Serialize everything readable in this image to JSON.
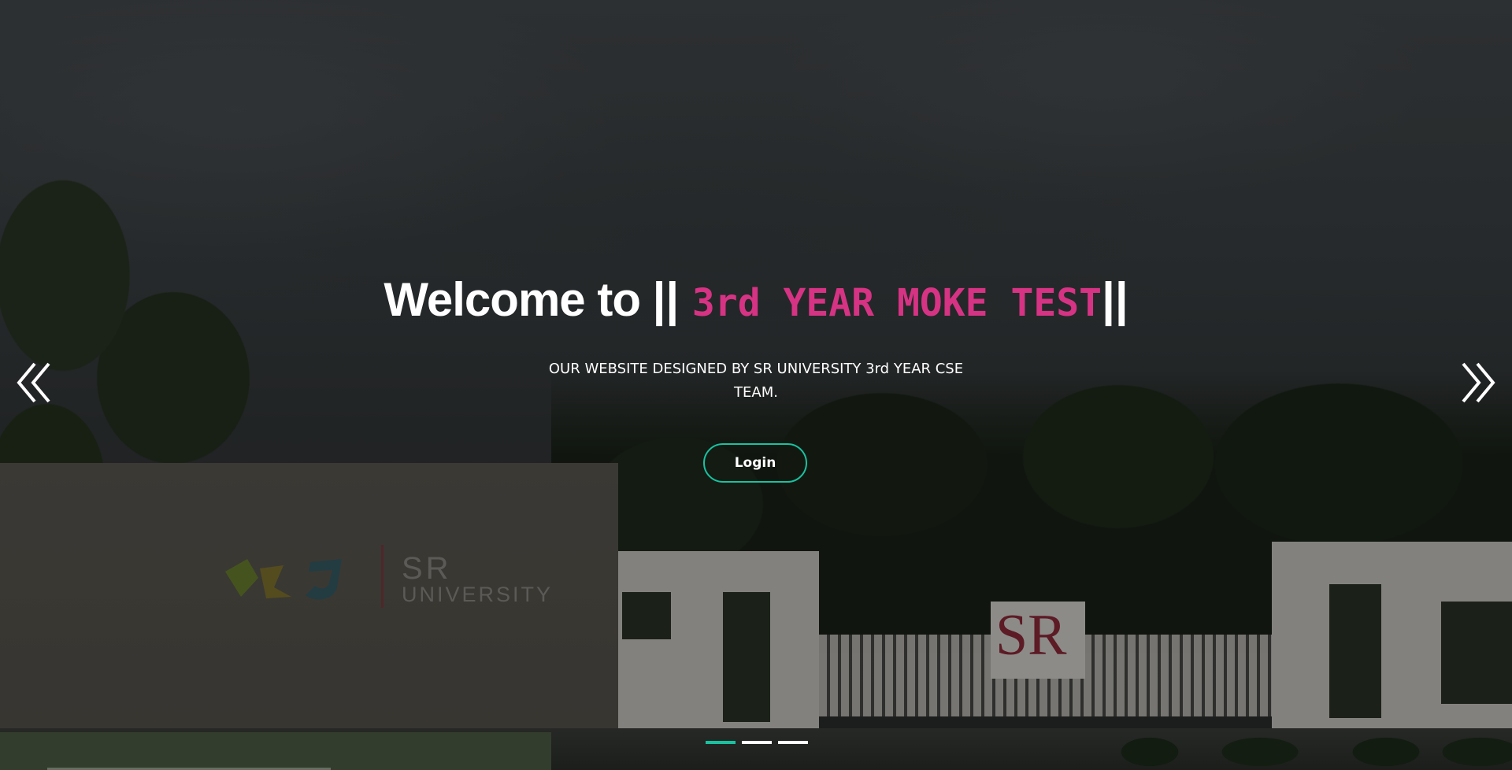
{
  "hero": {
    "title_prefix": "Welcome to ",
    "title_bar_open": "|| ",
    "typed_text": "3rd YEAR MOKE TEST",
    "title_bar_close": "||",
    "subtitle": "OUR WEBSITE DESIGNED BY SR UNIVERSITY 3rd YEAR CSE TEAM.",
    "login_label": "Login"
  },
  "carousel": {
    "prev_icon": "double-chevron-left-icon",
    "next_icon": "double-chevron-right-icon",
    "slides_count": 3,
    "active_index": 0
  },
  "background": {
    "sign_logo_line1": "SR",
    "sign_logo_line2": "UNIVERSITY",
    "gate_sign": "SR"
  },
  "colors": {
    "accent": "#18c2a0",
    "typed_text": "#d63384",
    "text": "#ffffff"
  }
}
